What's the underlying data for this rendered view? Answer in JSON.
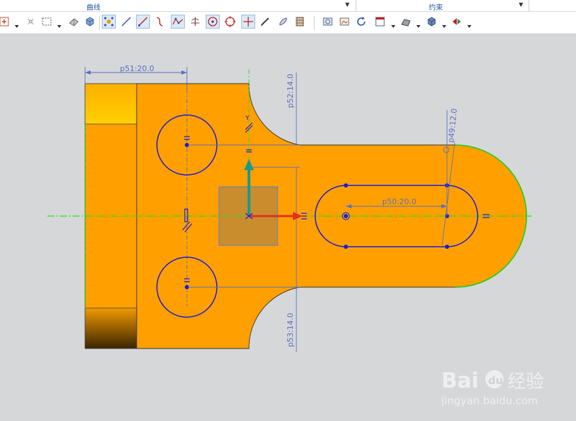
{
  "ribbon": {
    "groups": [
      {
        "label": "曲线"
      },
      {
        "label": "约束"
      }
    ]
  },
  "toolbar": {
    "tools": [
      {
        "icon": "sketch-point-icon"
      },
      {
        "icon": "snap-point-icon"
      },
      {
        "icon": "selection-box-icon"
      },
      {
        "icon": "shaded-solid-icon"
      },
      {
        "icon": "cube-icon"
      },
      {
        "icon": "vertex-select-icon"
      },
      {
        "icon": "line-icon"
      },
      {
        "icon": "line-tool-icon"
      },
      {
        "icon": "studio-spline-icon"
      },
      {
        "icon": "polyline-icon"
      },
      {
        "icon": "trim-icon"
      },
      {
        "icon": "circle-center-icon"
      },
      {
        "icon": "circle-icon"
      },
      {
        "icon": "crosshair-icon"
      },
      {
        "icon": "pen-icon"
      },
      {
        "icon": "brush-icon"
      },
      {
        "icon": "pattern-icon"
      },
      {
        "icon": "view-fit-icon"
      },
      {
        "icon": "image-icon"
      },
      {
        "icon": "refresh-icon"
      },
      {
        "icon": "window-icon"
      },
      {
        "icon": "surface-icon"
      },
      {
        "icon": "solid-box-icon"
      },
      {
        "icon": "display-mode-icon"
      }
    ]
  },
  "sketch": {
    "dimensions": {
      "p51": "p51:20.0",
      "p52": "p52:14.0",
      "p53": "p53:14.0",
      "p49": "p49:12.0",
      "p50": "p50:20.0"
    },
    "axis_label_y": "Y",
    "colors": {
      "part_fill": "#ffa000",
      "curve": "#1a1adc",
      "dimension": "#5b6fbf",
      "centerline": "#22e022",
      "x_axis": "#e03020",
      "y_axis": "#1a9a8a"
    }
  },
  "watermark": {
    "brand": "Bai",
    "brand_cn": "经验",
    "url": "jingyan.baidu.com"
  }
}
